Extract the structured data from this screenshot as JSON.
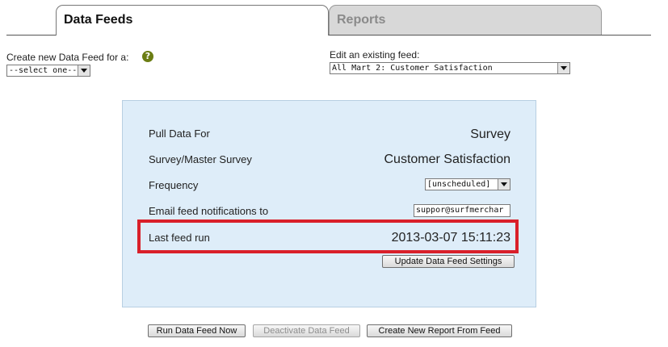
{
  "tabs": [
    {
      "label": "Data Feeds",
      "active": true
    },
    {
      "label": "Reports",
      "active": false
    }
  ],
  "create": {
    "label": "Create new Data Feed for a:",
    "help_icon": "?",
    "select_value": "--select one--"
  },
  "edit": {
    "label": "Edit an existing feed:",
    "select_value": "All Mart 2: Customer Satisfaction"
  },
  "details": {
    "pull_label": "Pull Data For",
    "pull_value": "Survey",
    "survey_label": "Survey/Master Survey",
    "survey_value": "Customer Satisfaction",
    "frequency_label": "Frequency",
    "frequency_value": "[unscheduled]",
    "email_label": "Email feed notifications to",
    "email_value": "suppor@surfmerchar",
    "last_run_label": "Last feed run",
    "last_run_value": "2013-03-07 15:11:23",
    "update_button": "Update Data Feed Settings"
  },
  "actions": {
    "run_now": "Run Data Feed Now",
    "deactivate": "Deactivate Data Feed",
    "create_report": "Create New Report From Feed"
  },
  "colors": {
    "panel_bg": "#deedf9",
    "highlight": "#d9202a",
    "help_icon": "#6b7d13"
  }
}
